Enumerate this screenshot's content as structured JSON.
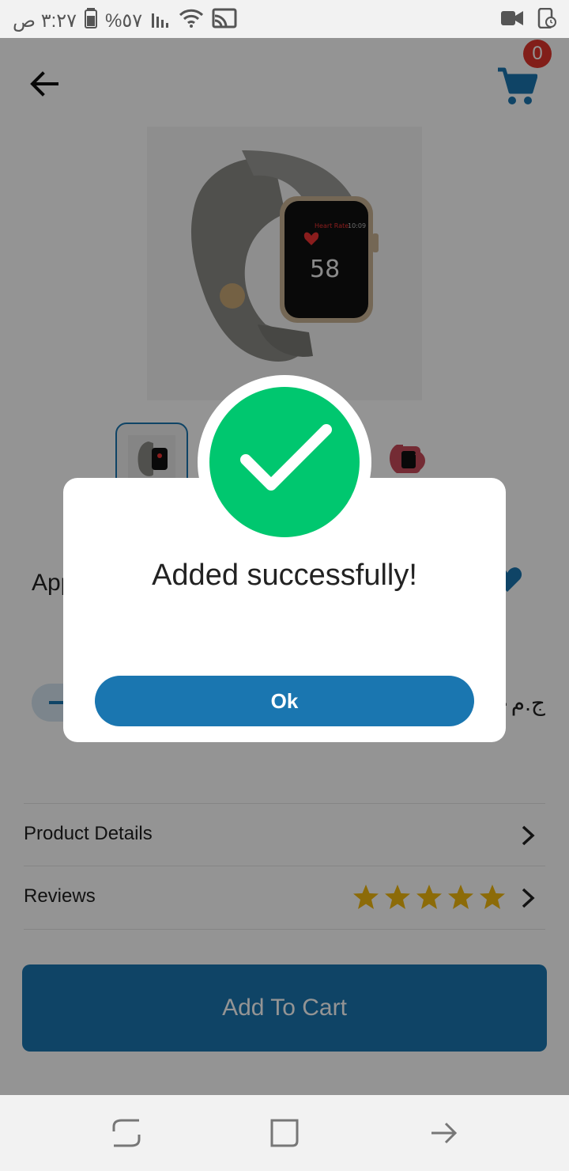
{
  "status_bar": {
    "time": "٣:٢٧ ص",
    "battery": "%٥٧",
    "icons": [
      "battery-icon",
      "signal-icon",
      "wifi-icon",
      "cast-icon",
      "video-icon",
      "screen-timer-icon"
    ]
  },
  "header": {
    "cart_count": "0",
    "icons": [
      "back-arrow-icon",
      "cart-icon"
    ]
  },
  "product": {
    "name_visible": "App",
    "price_visible": "ج.م٠",
    "image": "smartwatch",
    "thumbnails": 2
  },
  "sections": {
    "product_details_label": "Product Details",
    "reviews_label": "Reviews",
    "rating_stars": 5
  },
  "actions": {
    "add_to_cart_label": "Add To Cart"
  },
  "dialog": {
    "title": "Added successfully!",
    "ok_label": "Ok",
    "icon": "success-check-icon"
  },
  "colors": {
    "primary": "#1a76b0",
    "success": "#00c76f",
    "badge": "#e0352b",
    "star": "#f2b90f",
    "overlay": "rgba(0,0,0,0.42)"
  }
}
